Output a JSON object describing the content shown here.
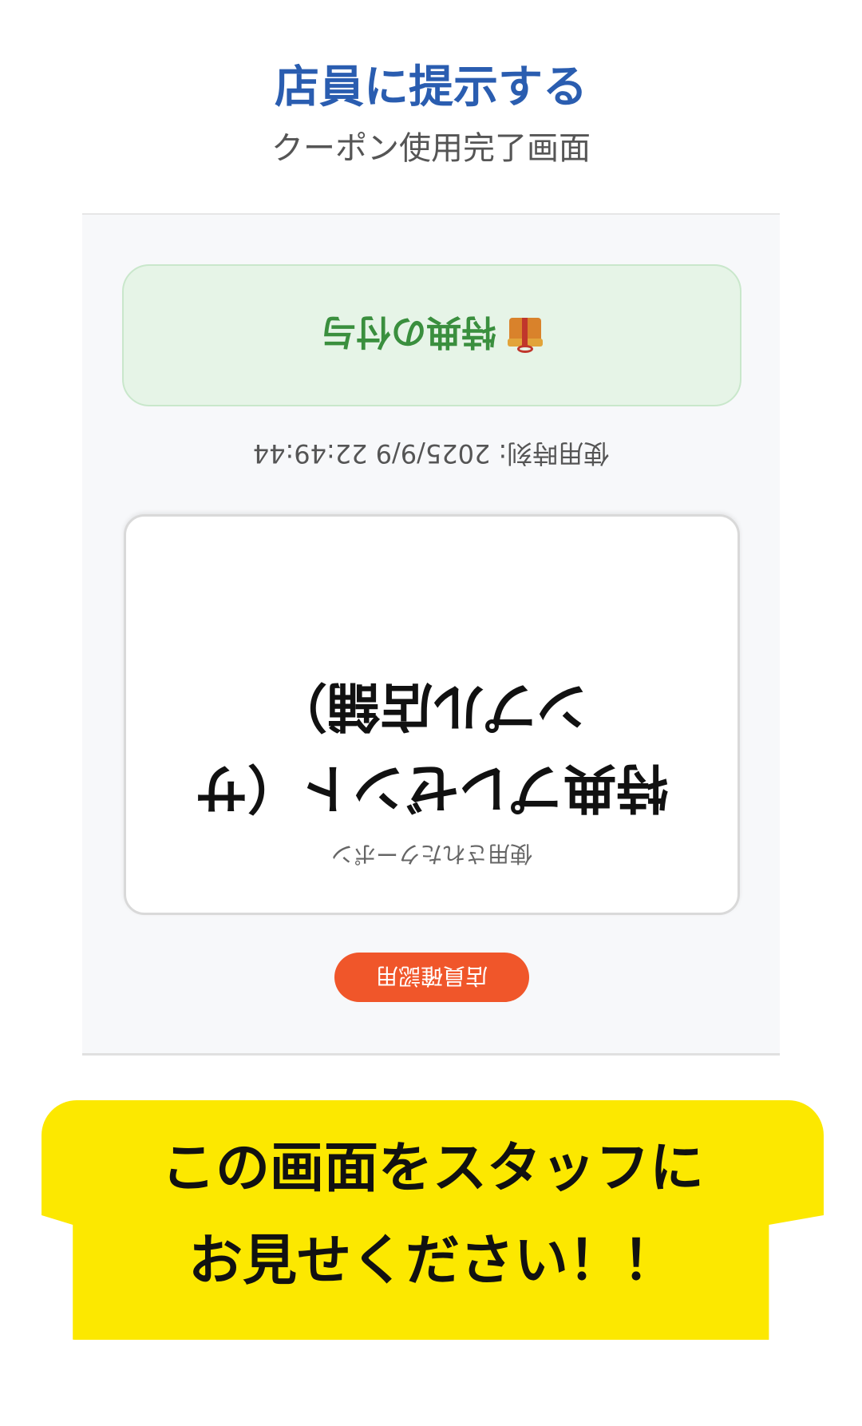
{
  "header": {
    "title": "店員に提示する",
    "subtitle": "クーポン使用完了画面"
  },
  "screen": {
    "badge_label": "特典の付与",
    "usage_time": "使用時刻: 2025/9/9 22:49:44",
    "coupon_name": "特典プレゼント（サンプル店舗）",
    "coupon_caption": "使用されたクーポン",
    "staff_button_label": "店員確認用",
    "accent_color": "#f0562a",
    "badge_color": "#3a8f3e",
    "orientation": "rotated 180°"
  },
  "notice": {
    "line1": "この画面をスタッフに",
    "line2": "お見せください！！",
    "background_color": "#fce800"
  }
}
